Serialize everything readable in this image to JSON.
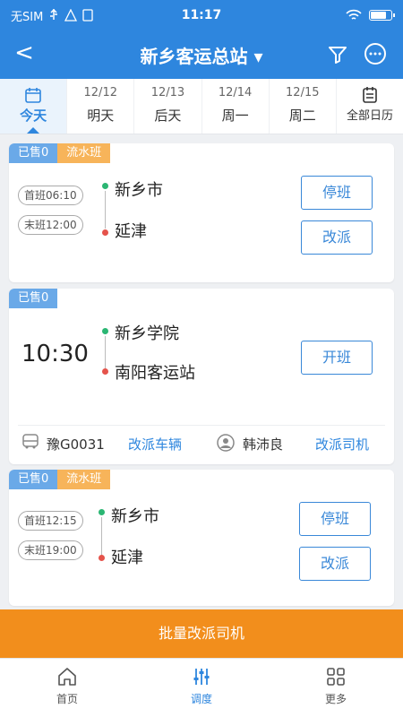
{
  "status": {
    "carrier": "无SIM",
    "time": "11:17",
    "battery_level": 0.8
  },
  "header": {
    "back": "<",
    "title": "新乡客运总站 ▾"
  },
  "dates": [
    {
      "top": "",
      "label": "今天"
    },
    {
      "top": "12/12",
      "label": "明天"
    },
    {
      "top": "12/13",
      "label": "后天"
    },
    {
      "top": "12/14",
      "label": "周一"
    },
    {
      "top": "12/15",
      "label": "周二"
    },
    {
      "top": "",
      "label": "全部日历"
    }
  ],
  "cards": [
    {
      "sold": "已售0",
      "type": "流水班",
      "first": "首班06:10",
      "last": "末班12:00",
      "from": "新乡市",
      "to": "延津",
      "btn1": "停班",
      "btn2": "改派"
    },
    {
      "sold": "已售0",
      "time": "10:30",
      "from": "新乡学院",
      "to": "南阳客运站",
      "btn1": "开班",
      "plate": "豫G0031",
      "change_vehicle": "改派车辆",
      "driver": "韩沛良",
      "change_driver": "改派司机"
    },
    {
      "sold": "已售0",
      "type": "流水班",
      "first": "首班12:15",
      "last": "末班19:00",
      "from": "新乡市",
      "to": "延津",
      "btn1": "停班",
      "btn2": "改派"
    }
  ],
  "batch_button": "批量改派司机",
  "tabbar": [
    {
      "label": "首页",
      "icon": "home-icon"
    },
    {
      "label": "调度",
      "icon": "sliders-icon"
    },
    {
      "label": "更多",
      "icon": "grid-icon"
    }
  ],
  "colors": {
    "primary": "#2e86de",
    "accent": "#f28e1c",
    "sold_tag": "#6aa9e8",
    "flow_tag": "#f7b45a"
  }
}
